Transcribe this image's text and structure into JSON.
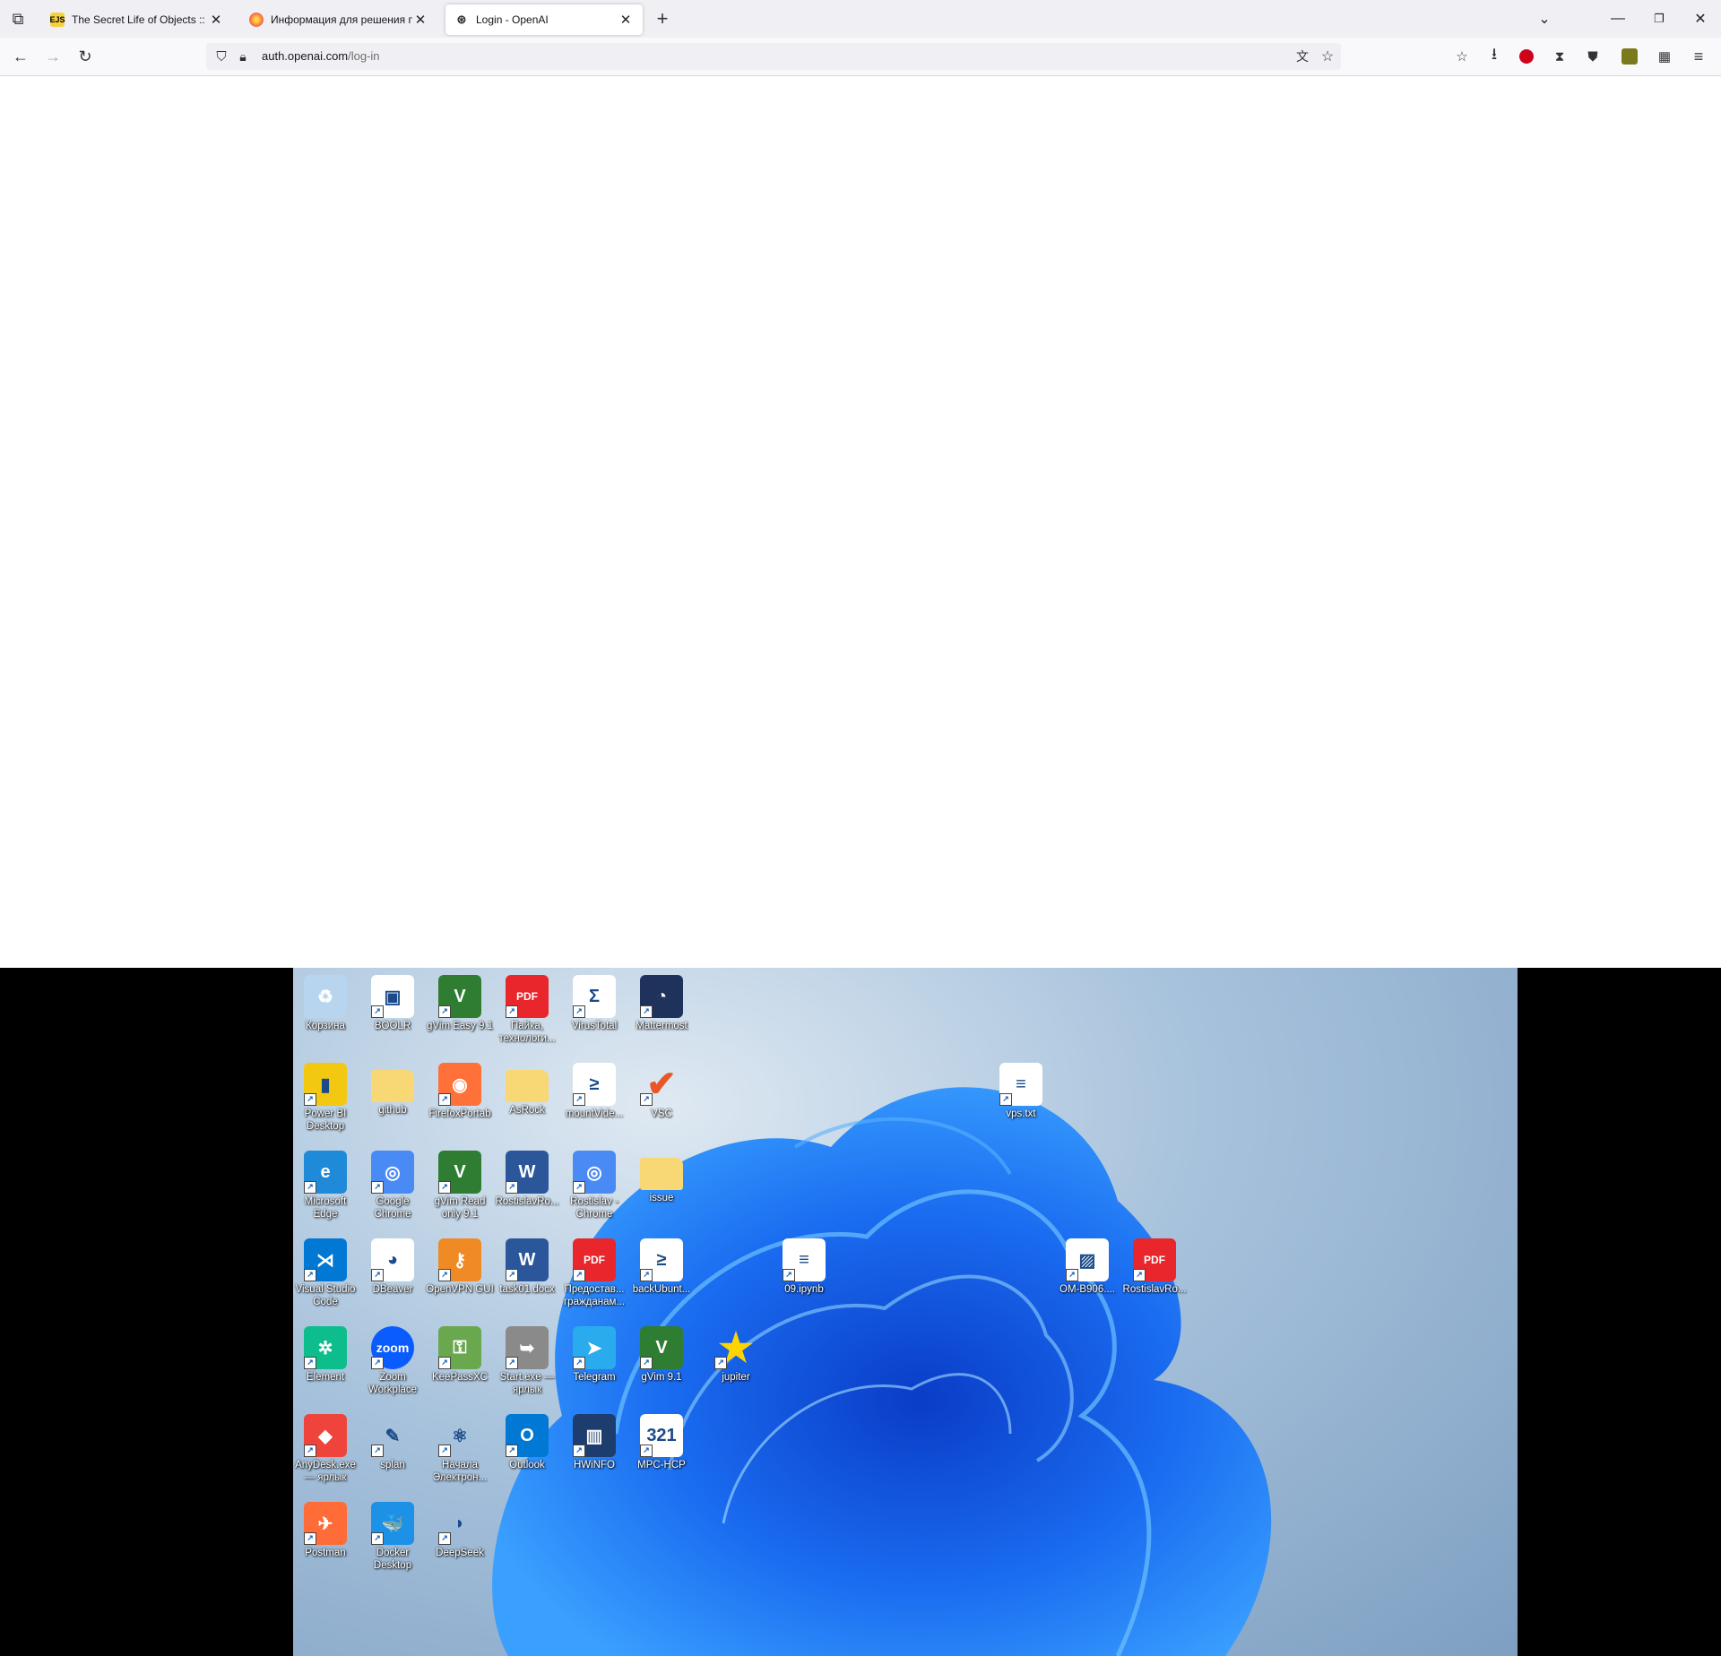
{
  "browser": {
    "tabs": [
      {
        "label": "The Secret Life of Objects :: Eloq",
        "favicon": "EJS",
        "active": false
      },
      {
        "label": "Информация для решения пр",
        "favicon": "firefox-icon",
        "active": false
      },
      {
        "label": "Login - OpenAI",
        "favicon": "openai-icon",
        "active": true
      }
    ],
    "new_tab": "+",
    "url_domain": "auth.openai.com",
    "url_path": "/log-in"
  },
  "desktop": {
    "icons": [
      {
        "label": "Корзина",
        "icon": "recycle-bin-icon",
        "color": "#b7d5ef",
        "glyph": "♻"
      },
      {
        "label": "BOOLR",
        "icon": "chip-icon",
        "color": "#ffffff",
        "glyph": "▣"
      },
      {
        "label": "gVim Easy 9.1",
        "icon": "vim-icon",
        "color": "#2e7d32",
        "glyph": "V"
      },
      {
        "label": "Пайка, технологи...",
        "icon": "pdf-icon",
        "color": "#e8262b",
        "glyph": "PDF"
      },
      {
        "label": "VirusTotal",
        "icon": "virustotal-icon",
        "color": "#ffffff",
        "glyph": "Σ"
      },
      {
        "label": "Mattermost",
        "icon": "mattermost-icon",
        "color": "#1e325c",
        "glyph": "◔"
      },
      {
        "label": "Power BI Desktop",
        "icon": "powerbi-icon",
        "color": "#f2c811",
        "glyph": "▮"
      },
      {
        "label": "github",
        "icon": "folder-icon",
        "color": "#f8d775",
        "glyph": ""
      },
      {
        "label": "FirefoxPortab",
        "icon": "firefox-icon",
        "color": "#ff7139",
        "glyph": "◉"
      },
      {
        "label": "AsRock",
        "icon": "folder-icon",
        "color": "#f8d775",
        "glyph": ""
      },
      {
        "label": "mountVide...",
        "icon": "script-icon",
        "color": "#ffffff",
        "glyph": "≥"
      },
      {
        "label": "VSC",
        "icon": "checkmark-icon",
        "color": "transparent",
        "glyph": "✔"
      },
      {
        "label": "Microsoft Edge",
        "icon": "edge-icon",
        "color": "#1f8ad8",
        "glyph": "e"
      },
      {
        "label": "Google Chrome",
        "icon": "chrome-icon",
        "color": "#4a8af4",
        "glyph": "◎"
      },
      {
        "label": "gVim Read only 9.1",
        "icon": "vim-icon",
        "color": "#2e7d32",
        "glyph": "V"
      },
      {
        "label": "RostislavRo...",
        "icon": "word-icon",
        "color": "#2b579a",
        "glyph": "W"
      },
      {
        "label": "Rostislav - Chrome",
        "icon": "chrome-profile-icon",
        "color": "#4a8af4",
        "glyph": "◎"
      },
      {
        "label": "issue",
        "icon": "folder-icon",
        "color": "#f8d775",
        "glyph": ""
      },
      {
        "label": "Visual Studio Code",
        "icon": "vscode-icon",
        "color": "#0078d4",
        "glyph": "⋊"
      },
      {
        "label": "DBeaver",
        "icon": "dbeaver-icon",
        "color": "#ffffff",
        "glyph": "◕"
      },
      {
        "label": "OpenVPN GUI",
        "icon": "openvpn-icon",
        "color": "#f08a24",
        "glyph": "⚷"
      },
      {
        "label": "task01.docx",
        "icon": "word-icon",
        "color": "#2b579a",
        "glyph": "W"
      },
      {
        "label": "Предостав... гражданам...",
        "icon": "pdf-icon",
        "color": "#e8262b",
        "glyph": "PDF"
      },
      {
        "label": "backUbunt...",
        "icon": "script-icon",
        "color": "#ffffff",
        "glyph": "≥"
      },
      {
        "label": "Element",
        "icon": "element-icon",
        "color": "#0dbd8b",
        "glyph": "✲"
      },
      {
        "label": "Zoom Workplace",
        "icon": "zoom-icon",
        "color": "#0b5cff",
        "glyph": "zoom"
      },
      {
        "label": "KeePassXC",
        "icon": "keepass-icon",
        "color": "#6aa84f",
        "glyph": "⚿"
      },
      {
        "label": "Start.exe — ярлык",
        "icon": "start-icon",
        "color": "#8a8a8a",
        "glyph": "➥"
      },
      {
        "label": "Telegram",
        "icon": "telegram-icon",
        "color": "#2aabee",
        "glyph": "➤"
      },
      {
        "label": "gVim 9.1",
        "icon": "vim-icon",
        "color": "#2e7d32",
        "glyph": "V"
      },
      {
        "label": "AnyDesk.exe — ярлык",
        "icon": "anydesk-icon",
        "color": "#ef443b",
        "glyph": "◆"
      },
      {
        "label": "splan",
        "icon": "pencil-icon",
        "color": "transparent",
        "glyph": "✎"
      },
      {
        "label": "Начала Электрон...",
        "icon": "molecule-icon",
        "color": "transparent",
        "glyph": "⚛"
      },
      {
        "label": "Outlook",
        "icon": "outlook-icon",
        "color": "#0078d4",
        "glyph": "O"
      },
      {
        "label": "HWiNFO",
        "icon": "hwinfo-icon",
        "color": "#1d3d6e",
        "glyph": "▥"
      },
      {
        "label": "MPC-HCP",
        "icon": "mpc-icon",
        "color": "#ffffff",
        "glyph": "321"
      },
      {
        "label": "Postman",
        "icon": "postman-icon",
        "color": "#ff6c37",
        "glyph": "✈"
      },
      {
        "label": "Docker Desktop",
        "icon": "docker-icon",
        "color": "#1d91e6",
        "glyph": "🐳"
      },
      {
        "label": "DeepSeek",
        "icon": "deepseek-icon",
        "color": "transparent",
        "glyph": "◗"
      },
      {
        "label": "vps.txt",
        "icon": "text-file-icon",
        "color": "#ffffff",
        "glyph": "≡"
      },
      {
        "label": "09.ipynb",
        "icon": "text-file-icon",
        "color": "#ffffff",
        "glyph": "≡"
      },
      {
        "label": "OM-B906....",
        "icon": "image-file-icon",
        "color": "#ffffff",
        "glyph": "▨"
      },
      {
        "label": "RostislavRo...",
        "icon": "pdf-icon",
        "color": "#e8262b",
        "glyph": "PDF"
      },
      {
        "label": "jupiter",
        "icon": "star-icon",
        "color": "transparent",
        "glyph": "★"
      }
    ]
  }
}
